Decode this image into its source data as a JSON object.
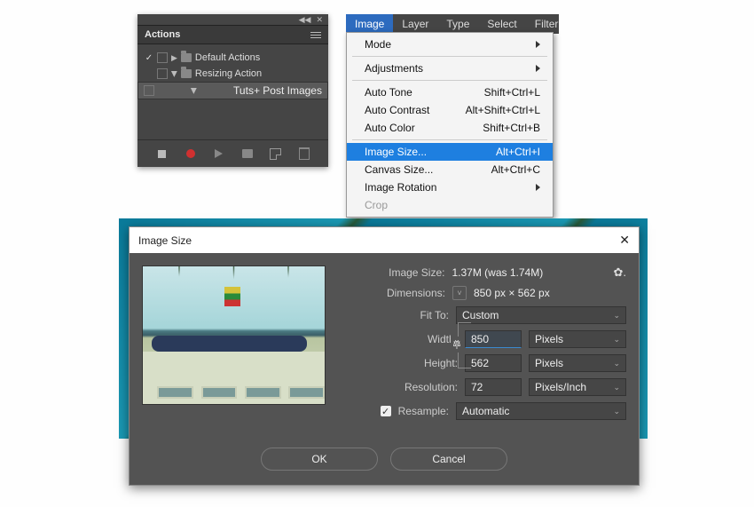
{
  "actions_panel": {
    "title": "Actions",
    "items": [
      {
        "label": "Default Actions"
      },
      {
        "label": "Resizing Action"
      },
      {
        "label": "Tuts+ Post Images"
      }
    ]
  },
  "menubar": {
    "items": [
      "Image",
      "Layer",
      "Type",
      "Select",
      "Filter"
    ]
  },
  "menu": {
    "mode": "Mode",
    "adjustments": "Adjustments",
    "auto_tone": {
      "label": "Auto Tone",
      "sc": "Shift+Ctrl+L"
    },
    "auto_contrast": {
      "label": "Auto Contrast",
      "sc": "Alt+Shift+Ctrl+L"
    },
    "auto_color": {
      "label": "Auto Color",
      "sc": "Shift+Ctrl+B"
    },
    "image_size": {
      "label": "Image Size...",
      "sc": "Alt+Ctrl+I"
    },
    "canvas_size": {
      "label": "Canvas Size...",
      "sc": "Alt+Ctrl+C"
    },
    "image_rotation": "Image Rotation",
    "crop": "Crop"
  },
  "dialog": {
    "title": "Image Size",
    "image_size_label": "Image Size:",
    "image_size_value": "1.37M (was 1.74M)",
    "dimensions_label": "Dimensions:",
    "dimensions_value": "850 px  ×  562 px",
    "fit_to_label": "Fit To:",
    "fit_to_value": "Custom",
    "width_label": "Width:",
    "width_value": "850",
    "width_unit": "Pixels",
    "height_label": "Height:",
    "height_value": "562",
    "height_unit": "Pixels",
    "resolution_label": "Resolution:",
    "resolution_value": "72",
    "resolution_unit": "Pixels/Inch",
    "resample_label": "Resample:",
    "resample_value": "Automatic",
    "ok": "OK",
    "cancel": "Cancel"
  }
}
